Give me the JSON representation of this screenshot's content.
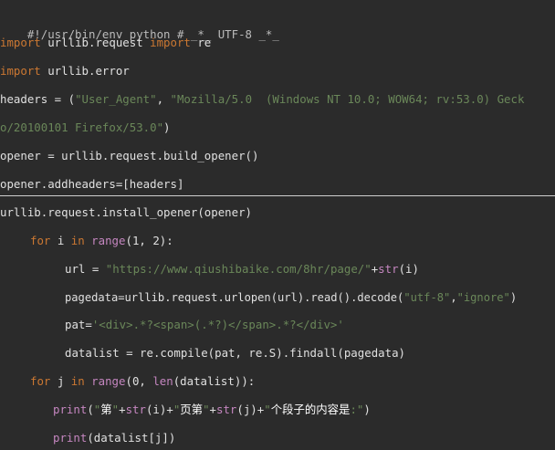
{
  "colors": {
    "background": "#2b2b2b",
    "keyword": "#cc7832",
    "string": "#6a8759",
    "builtin": "#c586c0",
    "text": "#e0e0e0",
    "divider": "#cfcfcf"
  },
  "code": {
    "l1": {
      "comment": "#!/usr/bin/env python # _*_ UTF-8 _*_"
    },
    "l2": {
      "kw1": "import",
      "t1": " urllib.request ",
      "kw2": "import",
      "t2": " re"
    },
    "l3": {
      "kw1": "import",
      "t1": " urllib.error"
    },
    "l4": {
      "t1": "headers = (",
      "s1": "\"User_Agent\"",
      "t2": ", ",
      "s2": "\"Mozilla/5.0  (Windows NT 10.0; WOW64; rv:53.0) Geck"
    },
    "l5": {
      "s1": "o/20100101 Firefox/53.0\"",
      "t1": ")"
    },
    "l6": {
      "t1": "opener = urllib.request.build_opener()"
    },
    "l7": {
      "t1": "opener.addheaders=[headers]"
    },
    "l8": {
      "t1": "urllib.request.install_opener(opener)"
    },
    "l9": {
      "kw1": "for",
      "t1": " i ",
      "kw2": "in",
      "t2": " ",
      "b1": "range",
      "t3": "(1, 2):"
    },
    "l10": {
      "t1": "url = ",
      "s1": "\"https://www.qiushibaike.com/8hr/page/\"",
      "t2": "+",
      "b1": "str",
      "t3": "(i)"
    },
    "l11": {
      "t1": "pagedata=urllib.request.urlopen(url).read().decode(",
      "s1": "\"utf-8\"",
      "t2": ",",
      "s2": "\"ignore\"",
      "t3": ")"
    },
    "l12": {
      "t1": "pat=",
      "s1": "'<div>.*?<span>(.*?)</span>.*?</div>'"
    },
    "l13": {
      "t1": "datalist = re.compile(pat, re.S).findall(pagedata)"
    },
    "l14": {
      "kw1": "for",
      "t1": " j ",
      "kw2": "in",
      "t2": " ",
      "b1": "range",
      "t3": "(0, ",
      "b2": "len",
      "t4": "(datalist)):"
    },
    "l15": {
      "b1": "print",
      "t1": "(",
      "s1": "\"",
      "c1": "第",
      "s2": "\"",
      "t2": "+",
      "b2": "str",
      "t3": "(i)+",
      "s3": "\"",
      "c2": "页第",
      "s4": "\"",
      "t4": "+",
      "b3": "str",
      "t5": "(j)+",
      "s5": "\"",
      "c3": "个段子的内容是",
      "s6": ":\"",
      "t6": ")"
    },
    "l16": {
      "b1": "print",
      "t1": "(datalist[j])"
    }
  }
}
